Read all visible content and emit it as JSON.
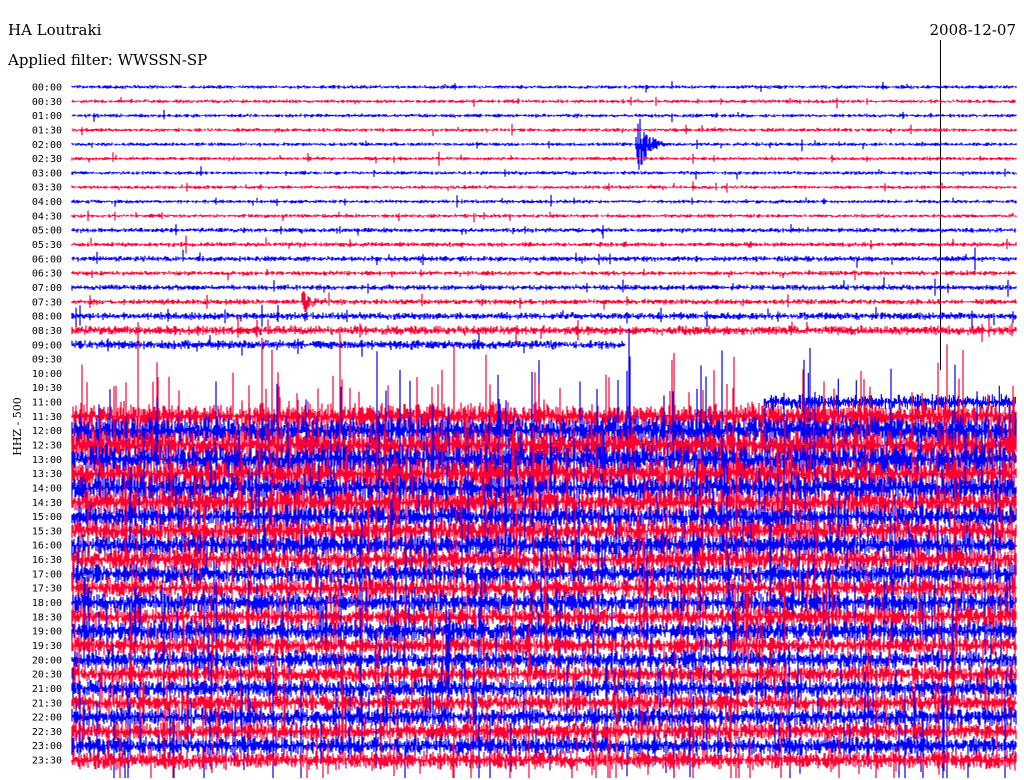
{
  "header": {
    "station": "HA Loutraki",
    "filter": "Applied filter: WWSSN-SP",
    "date": "2008-12-07"
  },
  "chart_data": {
    "type": "line",
    "title": "HA Loutraki",
    "ylabel": "HHZ - 500",
    "minutes_per_line": 30,
    "colors": {
      "even": "#0000ff",
      "odd": "#ff0033"
    },
    "row_labels": [
      "00:00",
      "00:30",
      "01:00",
      "01:30",
      "02:00",
      "02:30",
      "03:00",
      "03:30",
      "04:00",
      "04:30",
      "05:00",
      "05:30",
      "06:00",
      "06:30",
      "07:00",
      "07:30",
      "08:00",
      "08:30",
      "09:00",
      "09:30",
      "10:00",
      "10:30",
      "11:00",
      "11:30",
      "12:00",
      "12:30",
      "13:00",
      "13:30",
      "14:00",
      "14:30",
      "15:00",
      "15:30",
      "16:00",
      "16:30",
      "17:00",
      "17:30",
      "18:00",
      "18:30",
      "19:00",
      "19:30",
      "20:00",
      "20:30",
      "21:00",
      "21:30",
      "22:00",
      "22:30",
      "23:00",
      "23:30"
    ],
    "noise_amplitude": [
      2,
      2,
      2,
      2,
      2,
      2,
      2,
      2,
      2,
      2,
      2.5,
      2.5,
      3,
      2.5,
      3,
      3,
      4,
      5,
      5,
      0,
      0,
      0,
      8,
      14,
      16,
      16,
      16,
      16,
      14,
      14,
      12,
      12,
      12,
      12,
      11,
      11,
      11,
      11,
      11,
      10,
      10,
      10,
      10,
      10,
      10,
      10,
      10,
      10
    ],
    "coverage_minutes": [
      [
        0,
        30
      ],
      [
        0,
        30
      ],
      [
        0,
        30
      ],
      [
        0,
        30
      ],
      [
        0,
        30
      ],
      [
        0,
        30
      ],
      [
        0,
        30
      ],
      [
        0,
        30
      ],
      [
        0,
        30
      ],
      [
        0,
        30
      ],
      [
        0,
        30
      ],
      [
        0,
        30
      ],
      [
        0,
        30
      ],
      [
        0,
        30
      ],
      [
        0,
        30
      ],
      [
        0,
        30
      ],
      [
        0,
        30
      ],
      [
        0,
        30
      ],
      [
        0,
        17.6
      ],
      [
        0,
        0
      ],
      [
        0,
        0
      ],
      [
        0,
        0
      ],
      [
        22,
        30
      ],
      [
        0,
        30
      ],
      [
        0,
        30
      ],
      [
        0,
        30
      ],
      [
        0,
        30
      ],
      [
        0,
        30
      ],
      [
        0,
        30
      ],
      [
        0,
        30
      ],
      [
        0,
        30
      ],
      [
        0,
        30
      ],
      [
        0,
        30
      ],
      [
        0,
        30
      ],
      [
        0,
        30
      ],
      [
        0,
        30
      ],
      [
        0,
        30
      ],
      [
        0,
        30
      ],
      [
        0,
        30
      ],
      [
        0,
        30
      ],
      [
        0,
        30
      ],
      [
        0,
        30
      ],
      [
        0,
        30
      ],
      [
        0,
        30
      ],
      [
        0,
        30
      ],
      [
        0,
        30
      ],
      [
        0,
        30
      ],
      [
        0,
        30
      ]
    ],
    "events": [
      {
        "row": "02:00",
        "minute": 18,
        "amplitude": 30
      },
      {
        "row": "07:30",
        "minute": 7.4,
        "amplitude": 12
      }
    ],
    "marker_minute": 27.6
  }
}
